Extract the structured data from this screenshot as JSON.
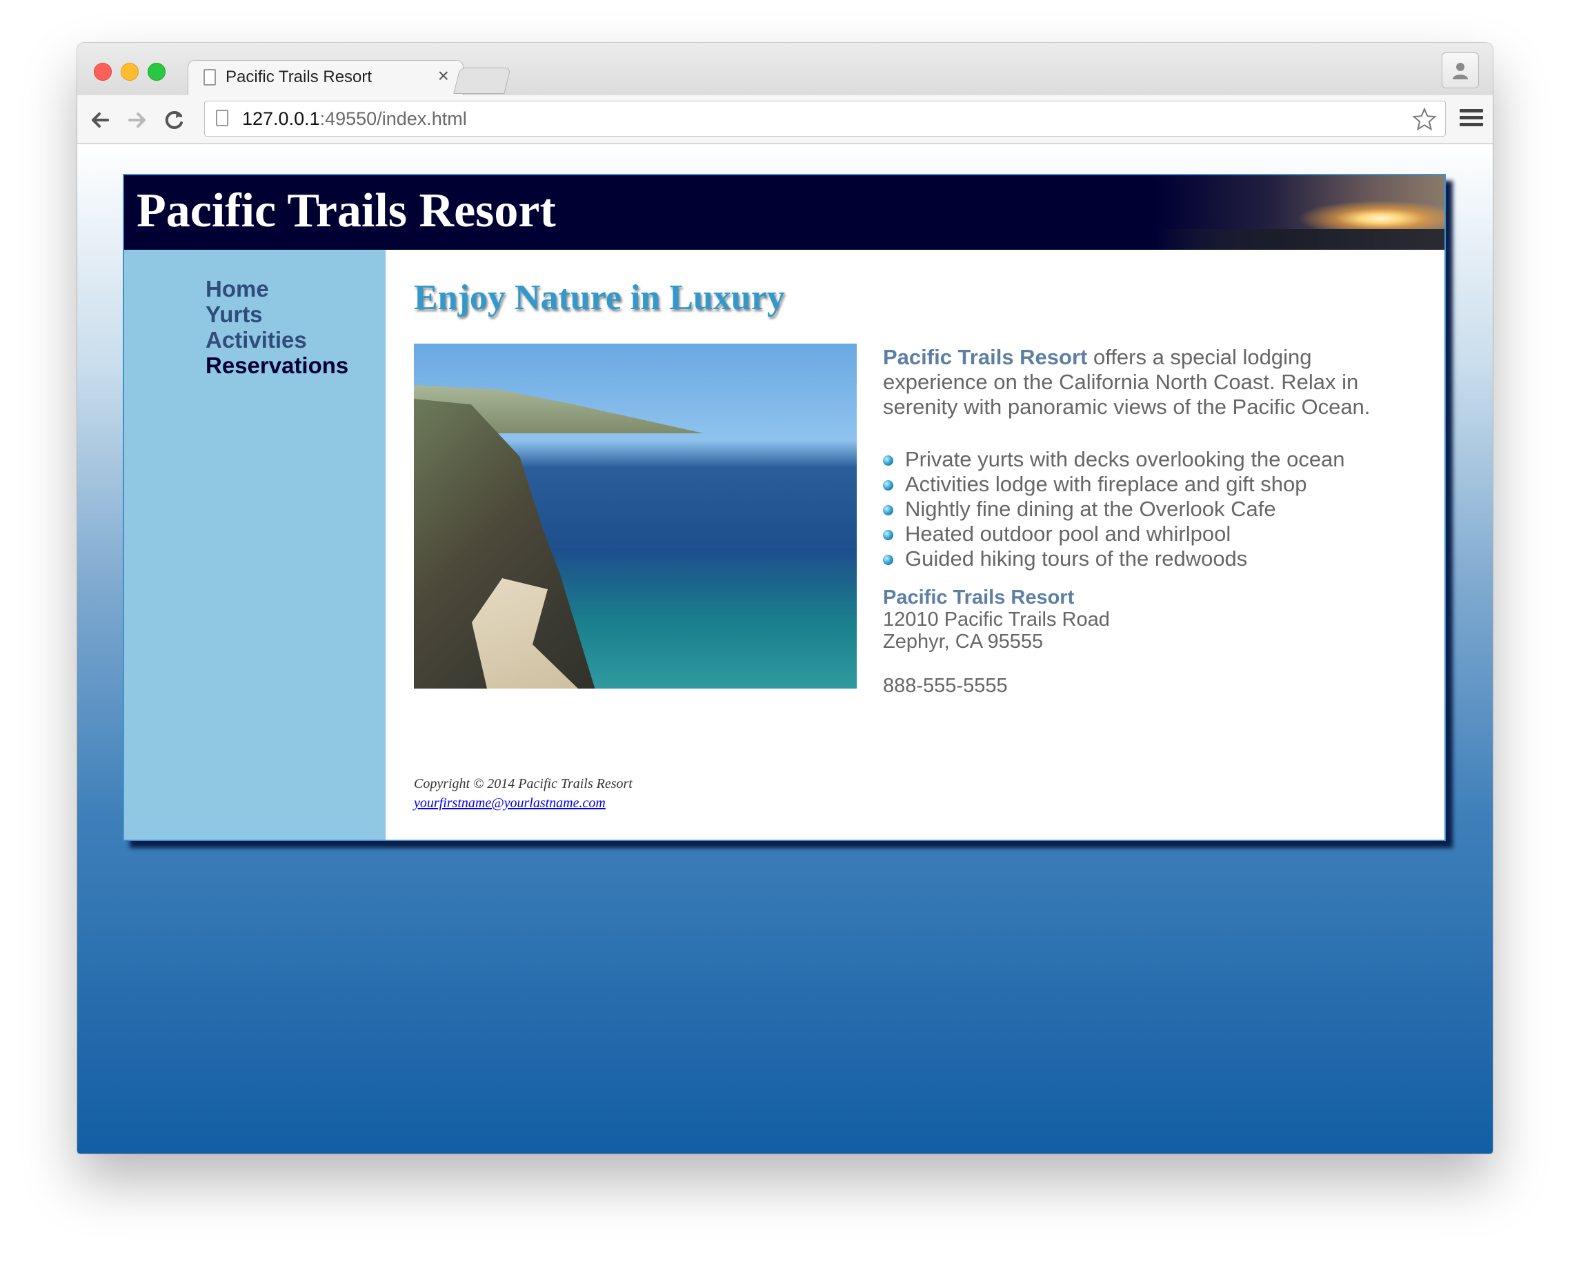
{
  "browser": {
    "tab_title": "Pacific Trails Resort",
    "tab_close": "×",
    "url_host": "127.0.0.1",
    "url_rest": ":49550/index.html"
  },
  "site": {
    "title": "Pacific Trails Resort",
    "nav": [
      {
        "label": "Home"
      },
      {
        "label": "Yurts"
      },
      {
        "label": "Activities"
      },
      {
        "label": "Reservations"
      }
    ],
    "heading": "Enjoy Nature in Luxury",
    "intro_brand": "Pacific Trails Resort",
    "intro_text": " offers a special lodging experience on the California North Coast. Relax in serenity with panoramic views of the Pacific Ocean.",
    "features": [
      "Private yurts with decks overlooking the ocean",
      "Activities lodge with fireplace and gift shop",
      "Nightly fine dining at the Overlook Cafe",
      "Heated outdoor pool and whirlpool",
      "Guided hiking tours of the redwoods"
    ],
    "address": {
      "name": "Pacific Trails Resort",
      "street": "12010 Pacific Trails Road",
      "city": "Zephyr, CA 95555",
      "phone": "888-555-5555"
    },
    "footer": {
      "copyright": "Copyright © 2014 Pacific Trails Resort",
      "email": "yourfirstname@yourlastname.com"
    }
  },
  "colors": {
    "header_bg": "#000033",
    "sidebar_bg": "#90c7e3",
    "heading": "#3399cc",
    "nav_link": "#304c7a",
    "brand": "#5c7fa3"
  },
  "icons": [
    "page-icon",
    "back-icon",
    "forward-icon",
    "reload-icon",
    "star-icon",
    "menu-icon",
    "profile-icon",
    "bullet-icon"
  ]
}
